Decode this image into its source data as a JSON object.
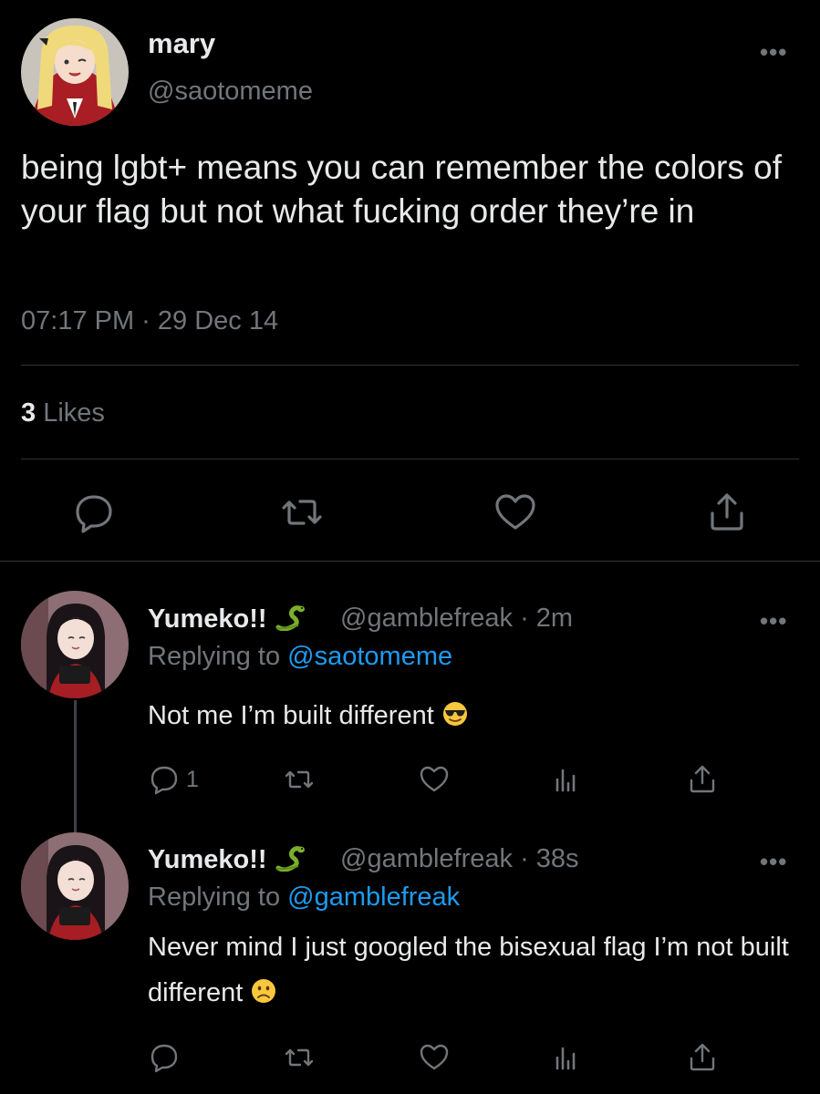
{
  "main_tweet": {
    "display_name": "mary",
    "handle": "@saotomeme",
    "text": "being lgbt+ means you can remember the colors of your flag but not what fucking order they’re in",
    "timestamp": "07:17 PM · 29 Dec 14",
    "likes_count": "3",
    "likes_label": "Likes"
  },
  "replies": [
    {
      "display_name": "Yumeko!!",
      "name_emoji": "🐍",
      "handle_time": "@gamblefreak · 2m",
      "replying_prefix": "Replying to",
      "replying_to": "@saotomeme",
      "text": "Not me I’m built different",
      "reply_count": "1"
    },
    {
      "display_name": "Yumeko!!",
      "name_emoji": "🐍",
      "handle_time": "@gamblefreak · 38s",
      "replying_prefix": "Replying to",
      "replying_to": "@gamblefreak",
      "text": "Never mind I just googled the bisexual flag I’m not built different"
    }
  ],
  "colors": {
    "background": "#000000",
    "text": "#e7e9ea",
    "secondary": "#71767b",
    "link": "#1d9bf0",
    "divider": "#2f3336"
  }
}
